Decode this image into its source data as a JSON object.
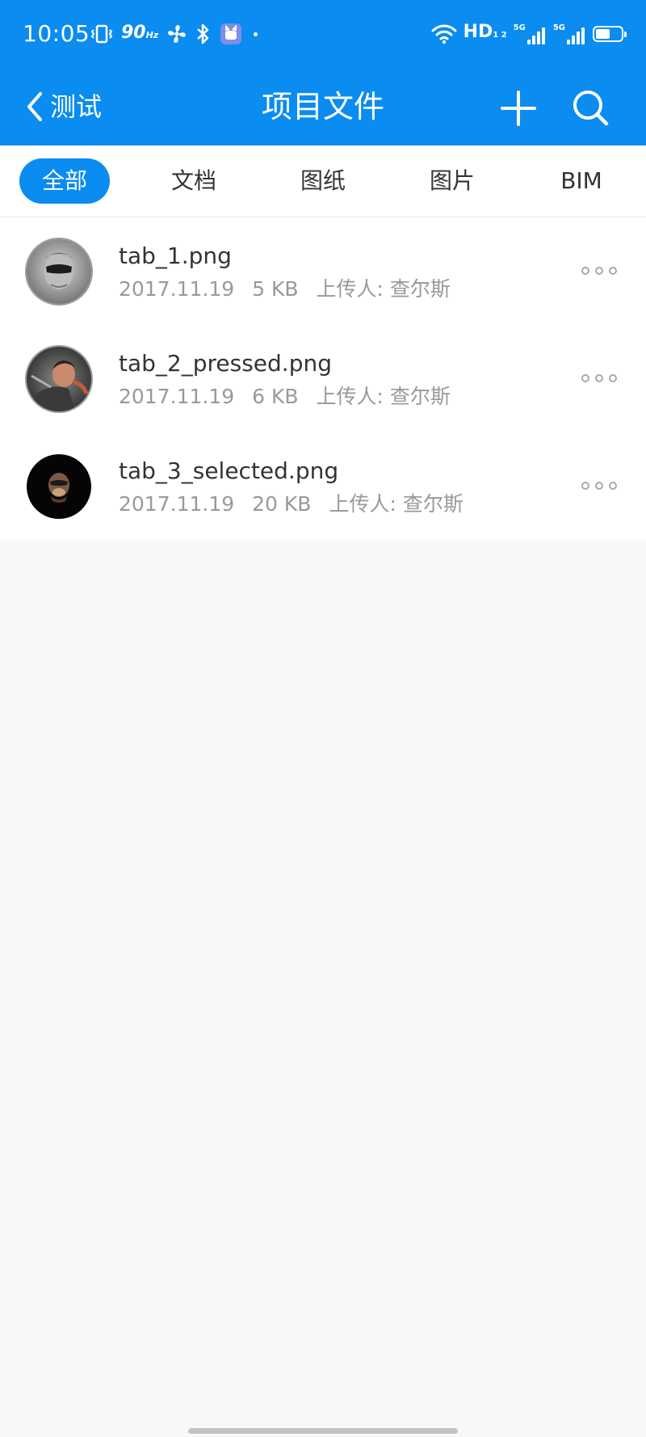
{
  "status_bar": {
    "time": "10:05",
    "refresh_rate": "90",
    "refresh_unit": "Hz",
    "network_label": "HD",
    "network_sub": "1 2",
    "signal_tag": "5G",
    "battery_level": 0.6,
    "icons": [
      "vibrate-icon",
      "fan-icon",
      "bluetooth-icon",
      "app-notification-icon",
      "dot-icon",
      "wifi-icon",
      "signal-icon",
      "signal-icon",
      "battery-icon"
    ]
  },
  "app_bar": {
    "back_label": "测试",
    "title": "项目文件",
    "back_icon": "chevron-left-icon",
    "add_icon": "plus-icon",
    "search_icon": "search-icon"
  },
  "tabs": [
    {
      "label": "全部",
      "active": true
    },
    {
      "label": "文档",
      "active": false
    },
    {
      "label": "图纸",
      "active": false
    },
    {
      "label": "图片",
      "active": false
    },
    {
      "label": "BIM",
      "active": false
    }
  ],
  "files": [
    {
      "name": "tab_1.png",
      "date": "2017.11.19",
      "size": "5 KB",
      "uploader": "上传人: 查尔斯"
    },
    {
      "name": "tab_2_pressed.png",
      "date": "2017.11.19",
      "size": "6 KB",
      "uploader": "上传人: 查尔斯"
    },
    {
      "name": "tab_3_selected.png",
      "date": "2017.11.19",
      "size": "20 KB",
      "uploader": "上传人: 查尔斯"
    }
  ],
  "colors": {
    "primary": "#0a8cf0",
    "page_background": "#f8f8f8",
    "text_primary": "#333333",
    "text_secondary": "#999999"
  }
}
